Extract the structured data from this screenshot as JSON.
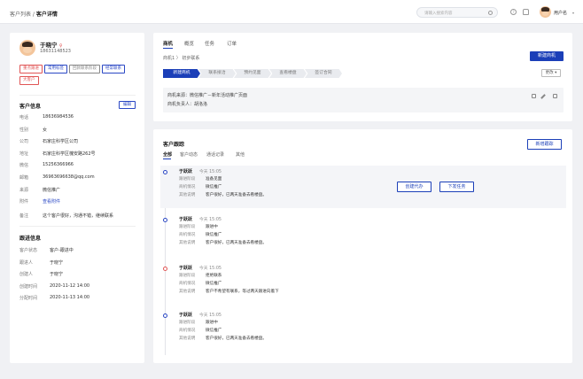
{
  "header": {
    "breadcrumb_parent": "客户列表",
    "breadcrumb_sep": " / ",
    "breadcrumb_current": "客户详情",
    "search_placeholder": "请输入搜索内容",
    "user_name": "用户名"
  },
  "customer": {
    "name": "于晓宁",
    "gender_symbol": "♀",
    "phone": "18631148523",
    "tags": [
      {
        "label": "重点跟进",
        "color": "#e05555"
      },
      {
        "label": "常用标签",
        "color": "#2a47c4"
      },
      {
        "label": "回款联系阶段",
        "color": "#888888"
      },
      {
        "label": "经常联系",
        "color": "#2a47c4"
      },
      {
        "label": "大客户",
        "color": "#e05555"
      }
    ]
  },
  "customer_info": {
    "title": "客户信息",
    "edit_label": "编辑",
    "fields": [
      {
        "k": "电话",
        "v": "18636984536"
      },
      {
        "k": "性别",
        "v": "女"
      },
      {
        "k": "公司",
        "v": "石家庄科学区公司"
      },
      {
        "k": "地址",
        "v": "石家庄科学区槐安路262号"
      },
      {
        "k": "微信",
        "v": "15256366966"
      },
      {
        "k": "邮箱",
        "v": "36963696638@qq.com"
      },
      {
        "k": "来源",
        "v": "微信推广"
      },
      {
        "k": "附件",
        "v": "查看附件"
      }
    ],
    "note_key": "备注",
    "note_value": "这个客户很好，沟通不错，继续联系"
  },
  "follow_info": {
    "title": "跟进信息",
    "fields": [
      {
        "k": "客户状态",
        "v": "客户-跟进中"
      },
      {
        "k": "跟进人",
        "v": "于晓宁"
      },
      {
        "k": "创建人",
        "v": "于晓宁"
      },
      {
        "k": "创建时间",
        "v": "2020-11-12 14:00"
      },
      {
        "k": "分配时间",
        "v": "2020-11-13 14:00"
      }
    ]
  },
  "opportunity": {
    "tabs": [
      "商机",
      "概览",
      "任务",
      "订单"
    ],
    "sub_crumb": "商机1 〉 初步联系",
    "new_button": "新建商机",
    "stages": [
      "新建商机",
      "联系接洽",
      "预约见面",
      "查看楼盘",
      "签订合同"
    ],
    "more_label": "更改 ▾",
    "source_line": "商机来源：微信推广－新年活动推广页面",
    "owner_line": "商机负责人：胡洛洛"
  },
  "followup": {
    "title": "客户跟踪",
    "new_button": "新增跟踪",
    "filters": [
      "全部",
      "客户动态",
      "通话记录",
      "其他"
    ],
    "keys": [
      "跟进阶段",
      "商机情况",
      "其他说明"
    ],
    "create_agent_button": "创建代办",
    "assign_task_button": "下发任务",
    "entries": [
      {
        "name": "于跃跃",
        "time": "今天  15:05",
        "stage": "准备见面",
        "status": "微信推广",
        "note": "客户很好，已两天准备去看楼盘。",
        "dot": "#2a47c4"
      },
      {
        "name": "于跃跃",
        "time": "今天  15:05",
        "stage": "跟进中",
        "status": "微信推广",
        "note": "客户很好，已两天准备去看楼盘。",
        "dot": "#2a47c4"
      },
      {
        "name": "于跃跃",
        "time": "今天  15:05",
        "stage": "拒绝联系",
        "status": "微信推广",
        "note": "客户不希望有联系，等过两天跟进向着下",
        "dot": "#e05555"
      },
      {
        "name": "于跃跃",
        "time": "今天  15:05",
        "stage": "跟进中",
        "status": "微信推广",
        "note": "客户很好，已两天准备去看楼盘。",
        "dot": "#2a47c4"
      }
    ]
  }
}
